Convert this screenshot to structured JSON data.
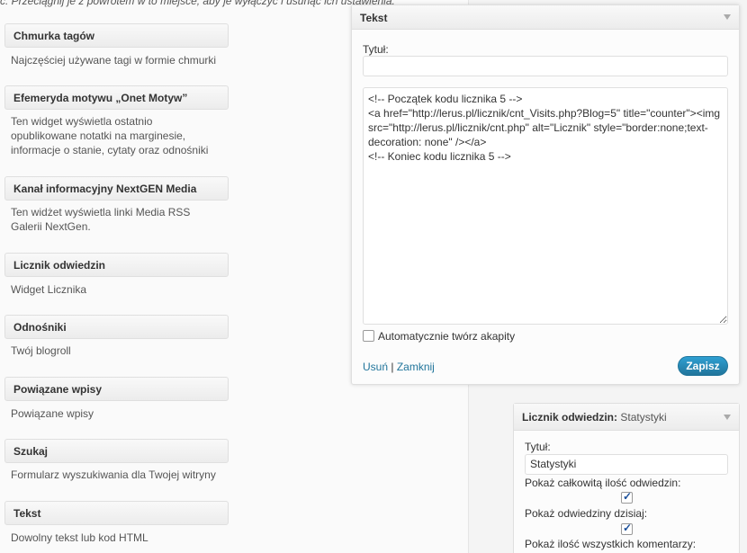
{
  "hint_text": "c. Przeciągnij je z powrotem w to miejsce, aby je wyłączyć i usunąć ich ustawienia.",
  "available_widgets": [
    {
      "title": "Chmurka tagów",
      "desc": "Najczęściej używane tagi w formie chmurki"
    },
    {
      "title": "Efemeryda motywu „Onet Motyw”",
      "desc": "Ten widget wyświetla ostatnio opublikowane notatki na marginesie, informacje o stanie, cytaty oraz odnośniki"
    },
    {
      "title": "Kanał informacyjny NextGEN Media",
      "desc": "Ten widżet wyświetla linki Media RSS Galerii NextGen."
    },
    {
      "title": "Licznik odwiedzin",
      "desc": "Widget Licznika"
    },
    {
      "title": "Odnośniki",
      "desc": "Twój blogroll"
    },
    {
      "title": "Powiązane wpisy",
      "desc": "Powiązane wpisy"
    },
    {
      "title": "Szukaj",
      "desc": "Formularz wyszukiwania dla Twojej witryny"
    },
    {
      "title": "Tekst",
      "desc": "Dowolny tekst lub kod HTML"
    }
  ],
  "text_widget": {
    "title": "Tekst",
    "title_label": "Tytuł:",
    "title_value": "",
    "content": "<!-- Początek kodu licznika 5 -->\n<a href=\"http://lerus.pl/licznik/cnt_Visits.php?Blog=5\" title=\"counter\"><img src=\"http://lerus.pl/licznik/cnt.php\" alt=\"Licznik\" style=\"border:none;text-decoration: none\" /></a>\n<!-- Koniec kodu licznika 5 -->",
    "auto_paragraph_label": "Automatycznie twórz akapity",
    "delete_label": "Usuń",
    "separator": "|",
    "close_label": "Zamknij",
    "save_label": "Zapisz"
  },
  "counter_widget": {
    "title": "Licznik odwiedzin:",
    "subtitle": "Statystyki",
    "title_label": "Tytuł:",
    "title_value": "Statystyki",
    "option1_label": "Pokaż całkowitą ilość odwiedzin:",
    "option2_label": "Pokaż odwiedziny dzisiaj:",
    "option3_label": "Pokaż ilość wszystkich komentarzy:"
  }
}
